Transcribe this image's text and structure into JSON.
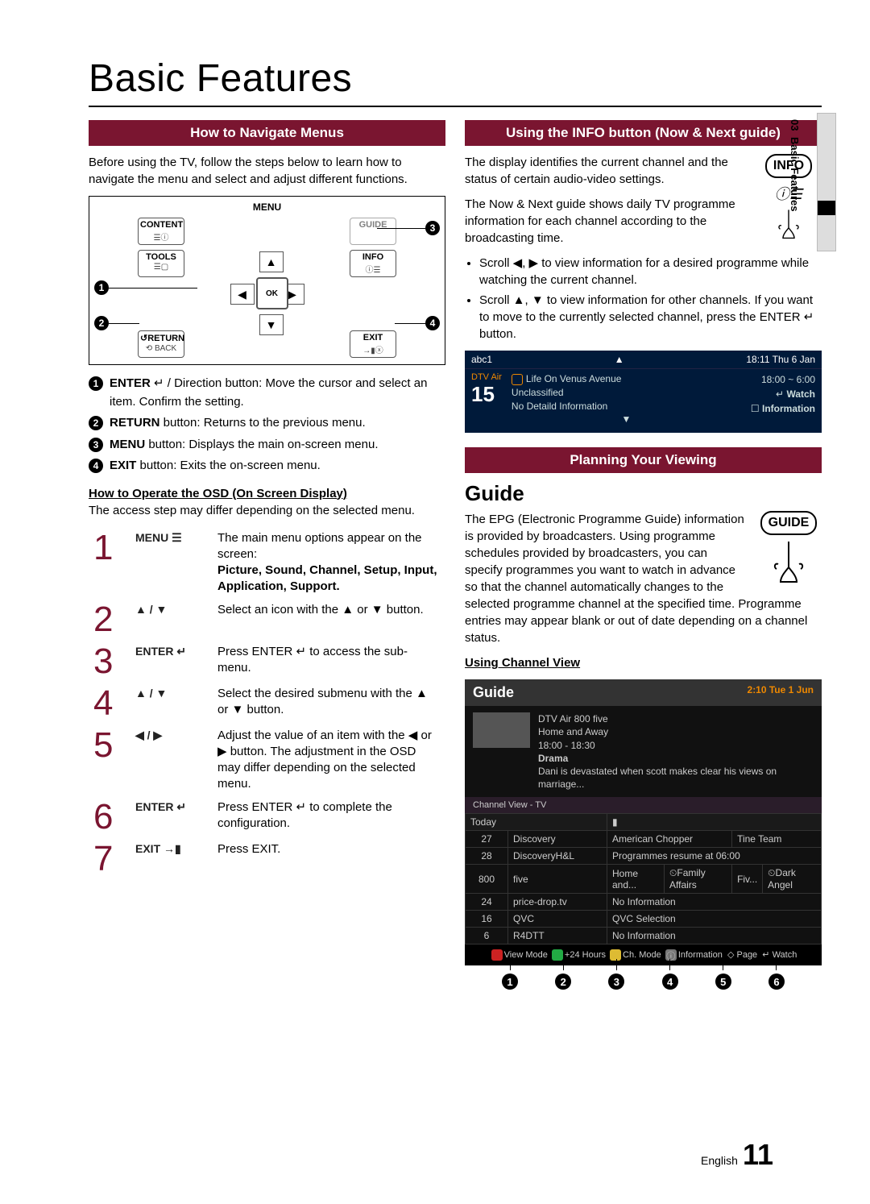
{
  "page": {
    "title": "Basic Features",
    "language": "English",
    "page_number": "11",
    "side_tab_chapter": "03",
    "side_tab_label": "Basic Features"
  },
  "left": {
    "section_title": "How to Navigate Menus",
    "intro": "Before using the TV, follow the steps below to learn how to navigate the menu and select and adjust different functions.",
    "remote": {
      "menu_label": "MENU",
      "keys": {
        "content": "CONTENT",
        "guide": "GUIDE",
        "tools": "TOOLS",
        "info": "INFO",
        "ok": "OK",
        "return": "RETURN",
        "back_sub": "BACK",
        "exit": "EXIT"
      },
      "callouts": [
        "1",
        "2",
        "3",
        "4"
      ]
    },
    "button_desc": [
      {
        "n": "1",
        "key": "ENTER",
        "sym": " ↵ ",
        "text": "/ Direction button: Move the cursor and select an item. Confirm the setting."
      },
      {
        "n": "2",
        "key": "RETURN",
        "text": " button: Returns to the previous menu."
      },
      {
        "n": "3",
        "key": "MENU",
        "text": " button: Displays the main on-screen menu."
      },
      {
        "n": "4",
        "key": "EXIT",
        "text": " button: Exits the on-screen menu."
      }
    ],
    "osd_title": "How to Operate the OSD (On Screen Display)",
    "osd_intro": "The access step may differ depending on the selected menu.",
    "steps": [
      {
        "n": "1",
        "key": "MENU ☰",
        "text": "The main menu options appear on the screen:",
        "bold_tail": "Picture, Sound, Channel, Setup, Input, Application, Support."
      },
      {
        "n": "2",
        "key": "▲ / ▼",
        "text": "Select an icon with the ▲ or ▼ button."
      },
      {
        "n": "3",
        "key": "ENTER ↵",
        "text": "Press ENTER ↵ to access the sub-menu."
      },
      {
        "n": "4",
        "key": "▲ / ▼",
        "text": "Select the desired submenu with the ▲ or ▼ button."
      },
      {
        "n": "5",
        "key": "◀ / ▶",
        "text": "Adjust the value of an item with the ◀ or ▶ button. The adjustment in the OSD may differ depending on the selected menu."
      },
      {
        "n": "6",
        "key": "ENTER ↵",
        "text": "Press ENTER ↵ to complete the configuration."
      },
      {
        "n": "7",
        "key": "EXIT →▮",
        "text": "Press EXIT."
      }
    ]
  },
  "right": {
    "section_title_info": "Using the INFO button (Now & Next guide)",
    "info_hand_label": "INFO",
    "info_p1": "The display identifies the current channel and the status of certain audio-video settings.",
    "info_p2": "The Now & Next guide shows daily TV programme information for each channel according to the broadcasting time.",
    "info_bullets": [
      "Scroll ◀, ▶ to view information for a desired programme while watching the current channel.",
      "Scroll ▲, ▼ to view information for other channels. If you want to move to the currently selected channel, press the ENTER ↵ button."
    ],
    "info_osd": {
      "chname": "abc1",
      "clock": "18:11 Thu 6 Jan",
      "service": "DTV Air",
      "chnum": "15",
      "prog_title": "Life On Venus Avenue",
      "rating": "Unclassified",
      "detail": "No Detaild Information",
      "time": "18:00 ~ 6:00",
      "watch": "Watch",
      "information": "Information"
    },
    "section_title_plan": "Planning Your Viewing",
    "guide_heading": "Guide",
    "guide_hand_label": "GUIDE",
    "guide_p": "The EPG (Electronic Programme Guide) information is provided by broadcasters. Using programme schedules provided by broadcasters, you can specify programmes you want to watch in advance so that the channel automatically changes to the selected programme channel at the specified time. Programme entries may appear blank or out of date depending on a channel status.",
    "using_channel_view": "Using  Channel View",
    "guide_osd": {
      "title": "Guide",
      "clock": "2:10 Tue 1 Jun",
      "now_ch": "DTV Air 800 five",
      "now_prog": "Home and Away",
      "now_time": "18:00 - 18:30",
      "now_genre": "Drama",
      "now_desc": "Dani is devastated when scott makes clear his views on marriage...",
      "tab_line": "Channel View - TV",
      "today": "Today",
      "rows": [
        {
          "num": "27",
          "name": "Discovery",
          "cells": [
            "American Chopper",
            "Tine Team"
          ]
        },
        {
          "num": "28",
          "name": "DiscoveryH&L",
          "cells": [
            "Programmes resume at 06:00"
          ]
        },
        {
          "num": "800",
          "name": "five",
          "cells": [
            "Home and...",
            "⏲Family Affairs",
            "Fiv...",
            "⏲Dark Angel"
          ]
        },
        {
          "num": "24",
          "name": "price-drop.tv",
          "cells": [
            "No Information"
          ]
        },
        {
          "num": "16",
          "name": "QVC",
          "cells": [
            "QVC Selection"
          ]
        },
        {
          "num": "6",
          "name": "R4DTT",
          "cells": [
            "No Information"
          ]
        }
      ],
      "legend": {
        "a": "View Mode",
        "b": "+24 Hours",
        "c": "Ch. Mode",
        "d": "Information",
        "e": "Page",
        "f": "Watch"
      }
    },
    "guide_callouts": [
      "1",
      "2",
      "3",
      "4",
      "5",
      "6"
    ]
  }
}
